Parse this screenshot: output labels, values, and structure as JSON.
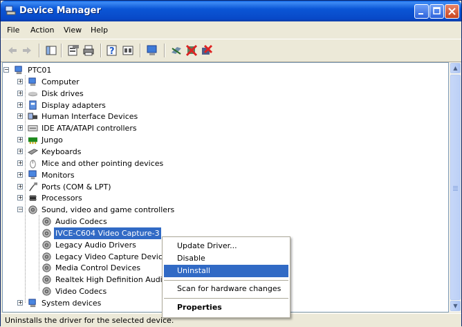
{
  "window": {
    "title": "Device Manager"
  },
  "menu": [
    "File",
    "Action",
    "View",
    "Help"
  ],
  "toolbar": [
    "back-arrow-icon",
    "forward-arrow-icon",
    "show-hide-tree-icon",
    "properties-icon",
    "print-icon",
    "help-icon",
    "view-icon",
    "computer-icon",
    "scan-hardware-icon",
    "disable-device-icon",
    "uninstall-device-icon"
  ],
  "tree": {
    "root": "PTC01",
    "categories": [
      {
        "label": "Computer",
        "icon": "computer-icon"
      },
      {
        "label": "Disk drives",
        "icon": "disk-drive-icon"
      },
      {
        "label": "Display adapters",
        "icon": "display-adapter-icon"
      },
      {
        "label": "Human Interface Devices",
        "icon": "hid-icon"
      },
      {
        "label": "IDE ATA/ATAPI controllers",
        "icon": "ide-controller-icon"
      },
      {
        "label": "Jungo",
        "icon": "jungo-icon"
      },
      {
        "label": "Keyboards",
        "icon": "keyboard-icon"
      },
      {
        "label": "Mice and other pointing devices",
        "icon": "mouse-icon"
      },
      {
        "label": "Monitors",
        "icon": "monitor-icon"
      },
      {
        "label": "Ports (COM & LPT)",
        "icon": "port-icon"
      },
      {
        "label": "Processors",
        "icon": "processor-icon"
      },
      {
        "label": "Sound, video and game controllers",
        "icon": "speaker-icon"
      }
    ],
    "sound_children": [
      "Audio Codecs",
      "IVCE-C604 Video Capture-3",
      "Legacy Audio Drivers",
      "Legacy Video Capture Devic",
      "Media Control Devices",
      "Realtek High Definition Audic",
      "Video Codecs"
    ],
    "last_category": "System devices"
  },
  "context_menu": {
    "update": "Update Driver...",
    "disable": "Disable",
    "uninstall": "Uninstall",
    "scan": "Scan for hardware changes",
    "properties": "Properties"
  },
  "status": "Uninstalls the driver for the selected device.",
  "colors": {
    "selection": "#316AC5",
    "titlebar": "#0B56D6"
  }
}
